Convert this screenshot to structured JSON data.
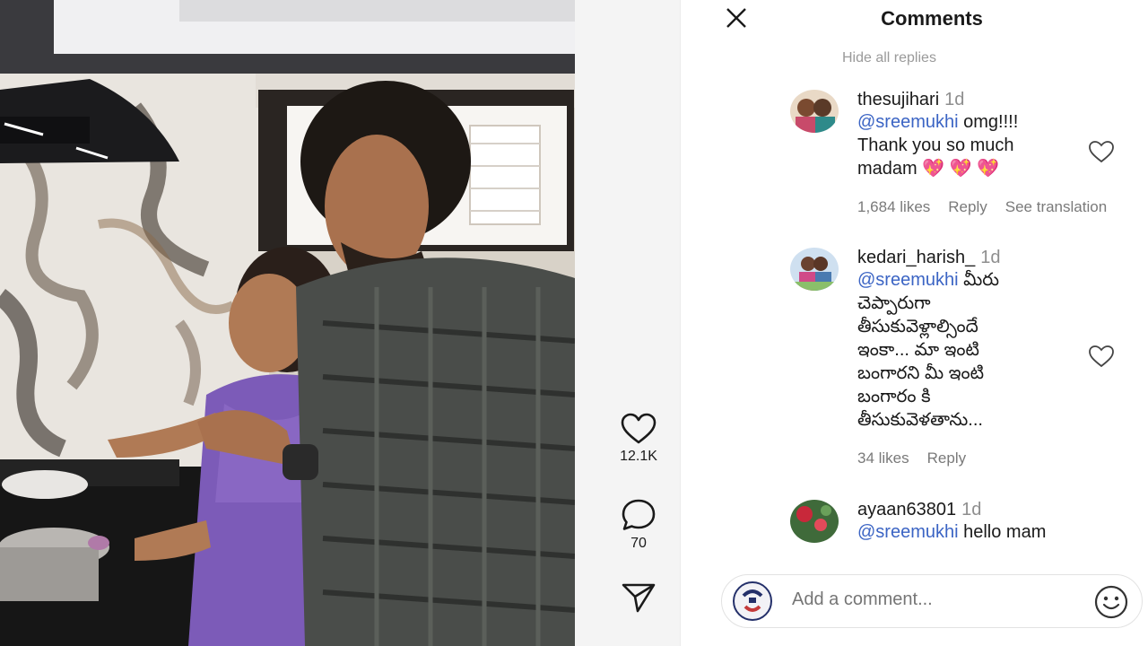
{
  "video": {
    "likes_count": "12.1K",
    "comments_count": "70"
  },
  "panel": {
    "title": "Comments",
    "hide_replies_label": "Hide all replies"
  },
  "comments": [
    {
      "username": "thesujihari",
      "time": "1d",
      "mention": "@sreemukhi",
      "text_first": " omg!!!!",
      "text_rest": "Thank you so much\nmadam 💖 💖 💖",
      "likes": "1,684 likes",
      "reply": "Reply",
      "translate": "See translation"
    },
    {
      "username": "kedari_harish_",
      "time": "1d",
      "mention": "@sreemukhi",
      "text_first": " మీరు",
      "text_rest": "చెప్పారుగా\nతీసుకువెళ్లాల్సిందే\nఇంకా... మా ఇంటి\nబంగారని మీ ఇంటి\nబంగారం కి\nతీసుకువెళతాను...",
      "likes": "34 likes",
      "reply": "Reply"
    },
    {
      "username": "ayaan63801",
      "time": "1d",
      "mention": "@sreemukhi",
      "text_first": " hello mam",
      "text_rest": ""
    }
  ],
  "composer": {
    "placeholder": "Add a comment..."
  },
  "icons": {
    "close": "close-icon",
    "like": "heart-icon",
    "comment": "comment-bubble-icon",
    "share": "paper-plane-icon",
    "emoji": "smiley-icon"
  },
  "colors": {
    "mention": "#3b64c4",
    "text": "#1a1a1a",
    "muted": "#7a7a7a"
  }
}
